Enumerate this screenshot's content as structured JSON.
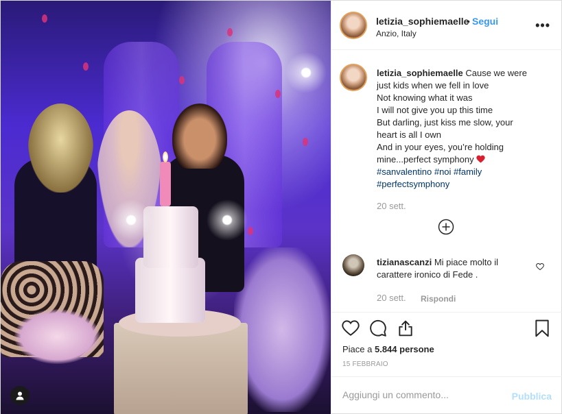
{
  "post": {
    "username": "letizia_sophiemaelle",
    "separator": "•",
    "follow_label": "Segui",
    "location": "Anzio, Italy",
    "more_label": "•••"
  },
  "caption": {
    "username": "letizia_sophiemaelle",
    "text_lines": [
      "Cause we were",
      "just kids when we fell in love",
      "Not knowing what it was",
      "I will not give you up this time",
      "But darling, just kiss me slow, your",
      "heart is all I own",
      "And in your eyes, you’re holding",
      "mine...perfect symphony"
    ],
    "hashtags_line1": "#sanvalentino #noi #family",
    "hashtags_line2": "#perfectsymphony",
    "date": "20 sett."
  },
  "comment": {
    "username": "tizianascanzi",
    "text": "Mi piace molto il carattere ironico di Fede .",
    "date": "20 sett.",
    "reply_label": "Rispondi"
  },
  "actions": {
    "likes_prefix": "Piace a ",
    "likes_count": "5.844",
    "likes_suffix": " persone",
    "post_date": "15 FEBBRAIO"
  },
  "add_comment": {
    "placeholder": "Aggiungi un commento...",
    "publish_label": "Pubblica"
  },
  "colors": {
    "link_blue": "#3897f0",
    "hashtag_blue": "#003569",
    "publish_disabled": "#b2dffc",
    "heart_red": "#ed4956"
  }
}
